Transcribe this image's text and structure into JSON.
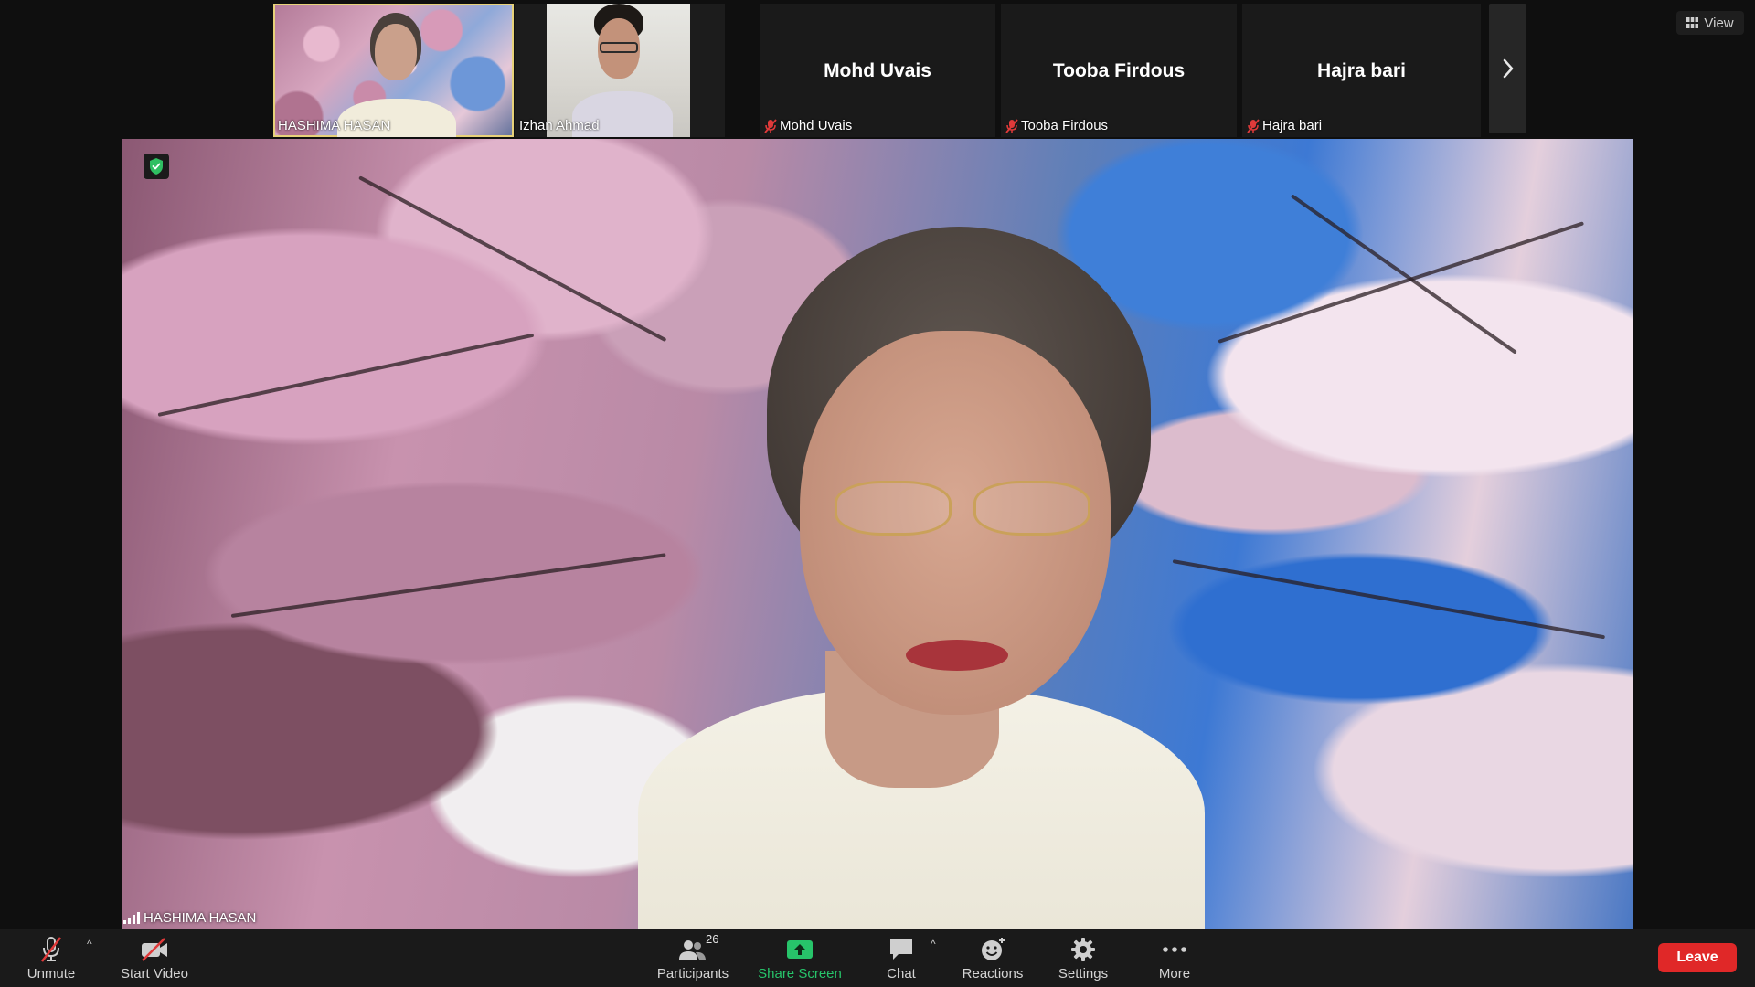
{
  "filmstrip": {
    "tiles": [
      {
        "label": "HASHIMA HASAN",
        "active": true,
        "video": true
      },
      {
        "label": "Izhan Ahmad",
        "active": false,
        "video": true
      },
      {
        "name": "Mohd Uvais",
        "label": "Mohd Uvais",
        "muted": true
      },
      {
        "name": "Tooba Firdous",
        "label": "Tooba Firdous",
        "muted": true
      },
      {
        "name": "Hajra bari",
        "label": "Hajra bari",
        "muted": true
      }
    ],
    "next_icon": "chevron-right-icon"
  },
  "view_button": {
    "label": "View",
    "icon": "grid-icon"
  },
  "main_video": {
    "speaker_label": "HASHIMA HASAN",
    "security_icon": "shield-check-icon"
  },
  "toolbar": {
    "unmute": {
      "label": "Unmute",
      "icon": "mic-off-icon"
    },
    "start_video": {
      "label": "Start Video",
      "icon": "video-off-icon"
    },
    "participants": {
      "label": "Participants",
      "count": "26",
      "icon": "participants-icon"
    },
    "share_screen": {
      "label": "Share Screen",
      "icon": "share-screen-icon"
    },
    "chat": {
      "label": "Chat",
      "icon": "chat-icon"
    },
    "reactions": {
      "label": "Reactions",
      "icon": "smiley-icon"
    },
    "settings": {
      "label": "Settings",
      "icon": "gear-icon"
    },
    "more": {
      "label": "More",
      "icon": "more-dots-icon"
    },
    "leave": {
      "label": "Leave"
    }
  },
  "colors": {
    "background": "#0f0f0f",
    "toolbar": "#1a1a1a",
    "active_outline": "#e7d27a",
    "muted_red": "#e03a3a",
    "share_green": "#27c46a",
    "leave_red": "#e02828"
  }
}
